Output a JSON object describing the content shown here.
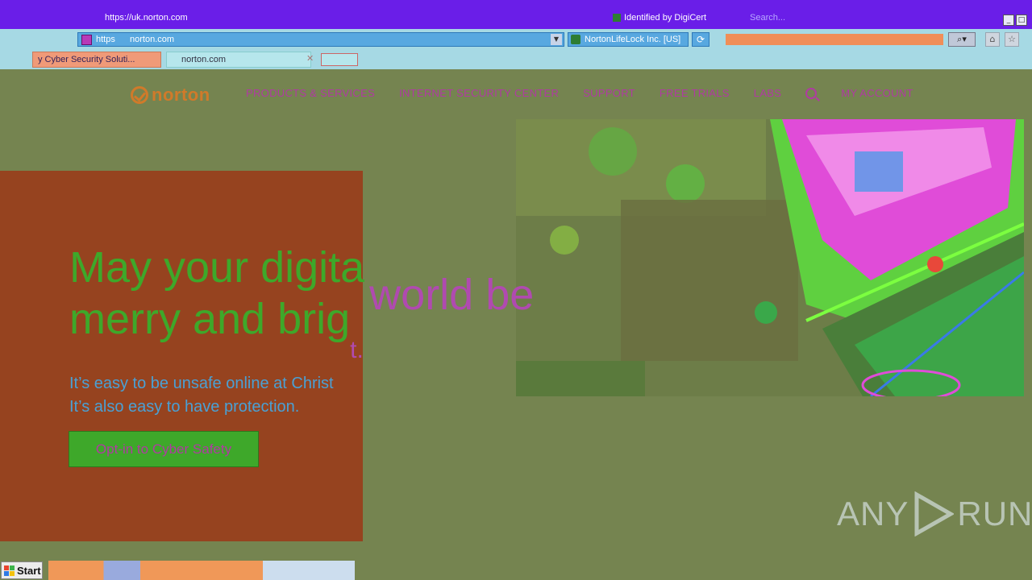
{
  "browser": {
    "title_url": "https://uk.norton.com",
    "identity": "Identified by DigiCert",
    "search_placeholder": "Search...",
    "address": {
      "scheme": "https",
      "domain": "norton.com"
    },
    "certificate": "NortonLifeLock Inc. [US]",
    "tabs": [
      {
        "label": "y Cyber Security Soluti..."
      },
      {
        "label": "norton.com"
      }
    ],
    "window_buttons": [
      "_",
      "□"
    ]
  },
  "site": {
    "logo_text": "norton",
    "nav": [
      "PRODUCTS & SERVICES",
      "INTERNET SECURITY CENTER",
      "SUPPORT",
      "FREE TRIALS",
      "LABS",
      "MY ACCOUNT"
    ],
    "hero": {
      "title_line1": "May your digita",
      "title_overflow1": "world be",
      "title_line2": "merry and brig",
      "title_overflow2": "t.",
      "subtitle_line1": "It’s easy to be unsafe online at Christ",
      "subtitle_line2": "It’s also easy to have protection.",
      "cta": "Opt-in to Cyber Safety"
    }
  },
  "watermark": {
    "left": "ANY",
    "right": "RUN"
  },
  "taskbar": {
    "start": "Start"
  },
  "colors": {
    "page_bg": "#758450",
    "hero_panel": "#96431f",
    "accent_green": "#3ea82a",
    "nav_text": "#b03aa2",
    "logo": "#d07a2a"
  }
}
